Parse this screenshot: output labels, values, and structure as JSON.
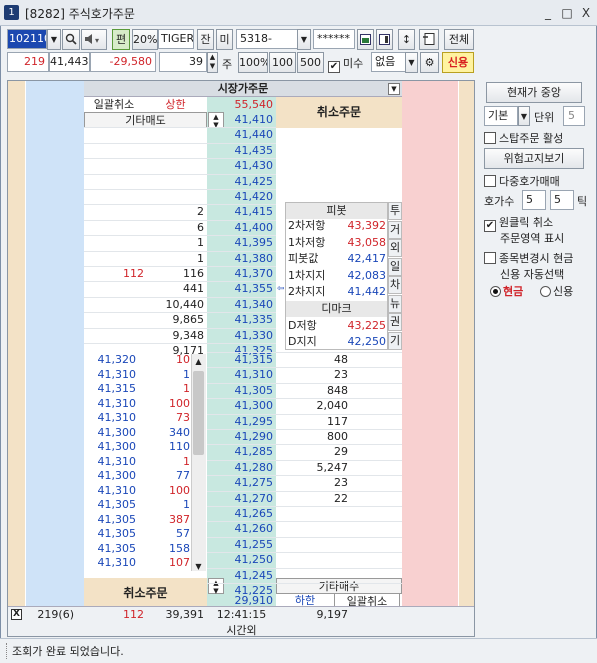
{
  "window": {
    "badge": "1",
    "title": "[8282] 주식호가주문",
    "min": "_",
    "max": "□",
    "close": "X"
  },
  "toolbar1": {
    "code": "102110",
    "font": "편",
    "ratio": "20%",
    "name": "TIGER",
    "j": "잔",
    "m": "미",
    "account": "5318-",
    "password": "******",
    "all_btn": "전체"
  },
  "toolbar2": {
    "qty": "219",
    "price": "41,443",
    "change": "-29,580",
    "order_qty": "39",
    "ju": "주",
    "pct100": "100%",
    "n100": "100",
    "n500": "500",
    "misu": "미수",
    "opt": "없음",
    "credit": "신용"
  },
  "header": {
    "market_order": "시장가주문",
    "bulk_cancel": "일괄취소",
    "upper": "상한",
    "upper_price": "55,540",
    "other_sell": "기타매도",
    "cancel_order": "취소주문",
    "cancel_order_bottom": "취소주문",
    "other_buy": "기타매수",
    "lower": "하한",
    "lower_price": "29,910",
    "bulk_cancel_bottom": "일괄취소"
  },
  "ask_rows": [
    {
      "qty": "",
      "price": "41,410"
    },
    {
      "qty": "",
      "price": "41,440"
    },
    {
      "qty": "",
      "price": "41,435"
    },
    {
      "qty": "",
      "price": "41,430"
    },
    {
      "qty": "",
      "price": "41,425"
    },
    {
      "qty": "",
      "price": "41,420"
    },
    {
      "qty": "2",
      "price": "41,415"
    },
    {
      "qty": "6",
      "price": "41,400"
    },
    {
      "qty": "1",
      "price": "41,395"
    },
    {
      "qty": "1",
      "price": "41,380"
    },
    {
      "qty": "116",
      "price": "41,370",
      "extra": "112"
    },
    {
      "qty": "441",
      "price": "41,355"
    },
    {
      "qty": "10,440",
      "price": "41,340"
    },
    {
      "qty": "9,865",
      "price": "41,335"
    },
    {
      "qty": "9,348",
      "price": "41,330"
    },
    {
      "qty": "9,171",
      "price": "41,325"
    }
  ],
  "bid_rows": [
    {
      "price": "41,315",
      "qty": "48"
    },
    {
      "price": "41,310",
      "qty": "23"
    },
    {
      "price": "41,305",
      "qty": "848"
    },
    {
      "price": "41,300",
      "qty": "2,040"
    },
    {
      "price": "41,295",
      "qty": "117"
    },
    {
      "price": "41,290",
      "qty": "800"
    },
    {
      "price": "41,285",
      "qty": "29"
    },
    {
      "price": "41,280",
      "qty": "5,247"
    },
    {
      "price": "41,275",
      "qty": "23"
    },
    {
      "price": "41,270",
      "qty": "22"
    },
    {
      "price": "41,265",
      "qty": ""
    },
    {
      "price": "41,260",
      "qty": ""
    },
    {
      "price": "41,255",
      "qty": ""
    },
    {
      "price": "41,250",
      "qty": ""
    },
    {
      "price": "41,245",
      "qty": ""
    },
    {
      "price": "41,225",
      "qty": ""
    }
  ],
  "trades": [
    {
      "price": "41,320",
      "qty": "10",
      "c": "red"
    },
    {
      "price": "41,310",
      "qty": "1",
      "c": "blue"
    },
    {
      "price": "41,315",
      "qty": "1",
      "c": "red"
    },
    {
      "price": "41,310",
      "qty": "100",
      "c": "red"
    },
    {
      "price": "41,310",
      "qty": "73",
      "c": "red"
    },
    {
      "price": "41,300",
      "qty": "340",
      "c": "blue"
    },
    {
      "price": "41,300",
      "qty": "110",
      "c": "blue"
    },
    {
      "price": "41,310",
      "qty": "1",
      "c": "red"
    },
    {
      "price": "41,300",
      "qty": "77",
      "c": "blue"
    },
    {
      "price": "41,310",
      "qty": "100",
      "c": "red"
    },
    {
      "price": "41,305",
      "qty": "1",
      "c": "blue"
    },
    {
      "price": "41,305",
      "qty": "387",
      "c": "red"
    },
    {
      "price": "41,305",
      "qty": "57",
      "c": "blue"
    },
    {
      "price": "41,305",
      "qty": "158",
      "c": "blue"
    },
    {
      "price": "41,310",
      "qty": "107",
      "c": "red"
    }
  ],
  "pivot": {
    "title": "피봇",
    "rows": [
      {
        "label": "2차저항",
        "value": "43,392",
        "c": "red"
      },
      {
        "label": "1차저항",
        "value": "43,058",
        "c": "red"
      },
      {
        "label": "피봇값",
        "value": "42,417",
        "c": "blue"
      },
      {
        "label": "1차지지",
        "value": "42,083",
        "c": "blue"
      },
      {
        "label": "2차지지",
        "value": "41,442",
        "c": "blue"
      }
    ],
    "demark": "디마크",
    "demark_rows": [
      {
        "label": "D저항",
        "value": "43,225",
        "c": "red"
      },
      {
        "label": "D지지",
        "value": "42,250",
        "c": "blue"
      }
    ],
    "side_tabs": [
      "투",
      "거",
      "외",
      "일",
      "차",
      "뉴",
      "권",
      "기"
    ]
  },
  "footer": {
    "check": "X",
    "left_qty": "219(6)",
    "red_qty": "112",
    "total": "39,391",
    "time": "12:41:15",
    "right_total": "9,197",
    "after_hours": "시간외"
  },
  "right_panel": {
    "current_center": "현재가 중앙",
    "basic": "기본",
    "unit": "단위",
    "unit_val": "5",
    "star_order": "스탑주문 활성",
    "risk_view": "위험고지보기",
    "multi_price": "다중호가매매",
    "price_count": "호가수",
    "pc1": "5",
    "pc2": "5",
    "tick": "틱",
    "one_click": "원클릭 취소",
    "order_area": "주문영역 표시",
    "stock_change": "종목변경시 현금",
    "credit_auto": "신용 자동선택",
    "cash": "현금",
    "credit": "신용"
  },
  "status": {
    "message": "조회가 완료 되었습니다."
  }
}
